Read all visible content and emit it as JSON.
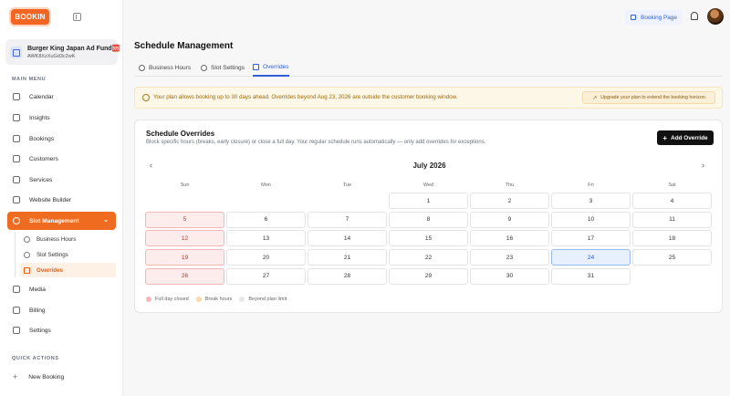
{
  "brand": {
    "logo_text": "BOOKIN"
  },
  "org": {
    "name": "Burger King Japan Ad Fund🆘",
    "id": "AWK8XzXuGd3c2wK"
  },
  "sidebar": {
    "main_menu_label": "MAIN MENU",
    "items": [
      {
        "label": "Calendar",
        "icon": "calendar-icon"
      },
      {
        "label": "Insights",
        "icon": "chart-icon"
      },
      {
        "label": "Bookings",
        "icon": "book-icon"
      },
      {
        "label": "Customers",
        "icon": "users-icon"
      },
      {
        "label": "Services",
        "icon": "briefcase-icon"
      },
      {
        "label": "Website Builder",
        "icon": "layout-icon"
      },
      {
        "label": "Slot Management",
        "icon": "clock-icon",
        "active": true
      },
      {
        "label": "Media",
        "icon": "image-icon"
      },
      {
        "label": "Billing",
        "icon": "card-icon"
      },
      {
        "label": "Settings",
        "icon": "gear-icon"
      }
    ],
    "sub_items": [
      {
        "label": "Business Hours",
        "icon": "clock-icon"
      },
      {
        "label": "Slot Settings",
        "icon": "gear-icon"
      },
      {
        "label": "Overrides",
        "icon": "calendar-icon",
        "active": true
      }
    ],
    "quick_actions_label": "QUICK ACTIONS",
    "quick_action": "New Booking"
  },
  "topbar": {
    "booking_page": "Booking Page"
  },
  "page": {
    "title": "Schedule Management"
  },
  "tabs": [
    {
      "label": "Business Hours",
      "icon": "clock-icon"
    },
    {
      "label": "Slot Settings",
      "icon": "gear-icon"
    },
    {
      "label": "Overrides",
      "icon": "calendar-icon",
      "active": true
    }
  ],
  "banner": {
    "text": "Your plan allows booking up to 30 days ahead. Overrides beyond Aug 23, 2026 are outside the customer booking window.",
    "button": "Upgrade your plan to extend the booking horizon"
  },
  "card": {
    "title": "Schedule Overrides",
    "subtitle": "Block specific hours (breaks, early closure) or close a full day. Your regular schedule runs automatically — only add overrides for exceptions.",
    "add_button": "Add Override"
  },
  "calendar": {
    "month": "July 2026",
    "days_of_week": [
      "Sun",
      "Mon",
      "Tue",
      "Wed",
      "Thu",
      "Fri",
      "Sat"
    ],
    "first_weekday": 3,
    "days_in_month": 31,
    "closed_days": [
      5,
      12,
      19,
      26
    ],
    "today": 24
  },
  "legend": [
    {
      "label": "Full day closed",
      "color": "#f6b7b7"
    },
    {
      "label": "Break hours",
      "color": "#f8d9a8"
    },
    {
      "label": "Beyond plan limit",
      "color": "#e5e7eb"
    }
  ],
  "colors": {
    "accent": "#ee6b1f",
    "link": "#2f5fd6"
  }
}
